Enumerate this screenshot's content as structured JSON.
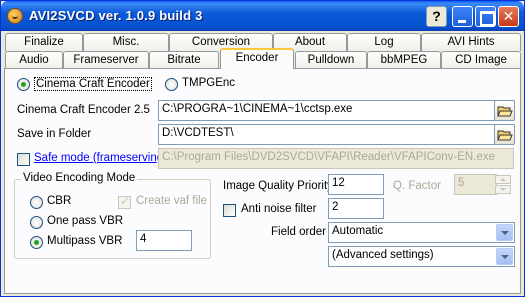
{
  "window": {
    "title": "AVI2SVCD ver. 1.0.9 build 3"
  },
  "tabs_row1": [
    {
      "label": "Finalize"
    },
    {
      "label": "Misc."
    },
    {
      "label": "Conversion"
    },
    {
      "label": "About"
    },
    {
      "label": "Log"
    },
    {
      "label": "AVI Hints"
    }
  ],
  "tabs_row2": [
    {
      "label": "Audio"
    },
    {
      "label": "Frameserver"
    },
    {
      "label": "Bitrate"
    },
    {
      "label": "Encoder"
    },
    {
      "label": "Pulldown"
    },
    {
      "label": "bbMPEG"
    },
    {
      "label": "CD Image"
    }
  ],
  "encoder": {
    "options": [
      {
        "label": "Cinema Craft Encoder",
        "selected": true
      },
      {
        "label": "TMPGEnc",
        "selected": false
      }
    ],
    "cce_label": "Cinema Craft Encoder 2.5",
    "cce_path": "C:\\PROGRA~1\\CINEMA~1\\cctsp.exe",
    "save_label": "Save in Folder",
    "save_path": "D:\\VCDTEST\\",
    "safe_mode_label": "Safe mode (frameserving)",
    "safe_mode_checked": false,
    "safe_mode_path": "C:\\Program Files\\DVD2SVCD\\VFAPI\\Reader\\VFAPIConv-EN.exe"
  },
  "video_mode": {
    "title": "Video Encoding Mode",
    "cbr_label": "CBR",
    "create_vaf_label": "Create vaf file",
    "create_vaf_checked": true,
    "one_pass_label": "One pass VBR",
    "multipass_label": "Multipass VBR",
    "multipass_value": "4",
    "selected": "Multipass VBR"
  },
  "quality": {
    "label": "Image Quality Priority",
    "value": "12",
    "q_factor_label": "Q. Factor",
    "q_factor_value": "5"
  },
  "anti_noise": {
    "label": "Anti noise filter",
    "checked": false,
    "value": "2"
  },
  "field_order": {
    "label": "Field order",
    "value": "Automatic",
    "advanced": "(Advanced settings)"
  }
}
